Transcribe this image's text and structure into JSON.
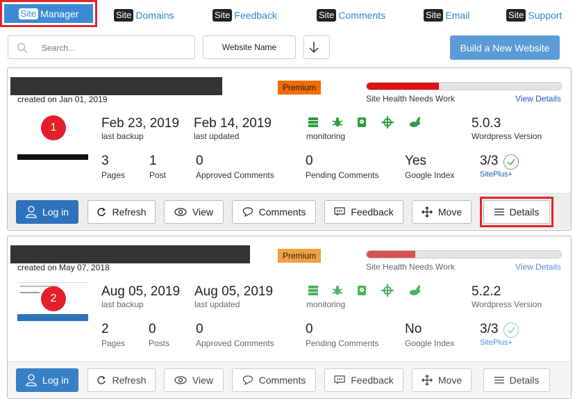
{
  "nav": {
    "site_tag": "Site",
    "items": [
      {
        "label": "Manager"
      },
      {
        "label": "Domains"
      },
      {
        "label": "Feedback"
      },
      {
        "label": "Comments"
      },
      {
        "label": "Email"
      },
      {
        "label": "Support"
      }
    ]
  },
  "toolbar": {
    "search_placeholder": "Search...",
    "sort_label": "Website Name",
    "build_label": "Build a New Website"
  },
  "sites": [
    {
      "badge": "1",
      "created": "created on Jan 01, 2019",
      "plan": "Premium",
      "plan_color": "#ef6c00",
      "health_label": "Site Health Needs Work",
      "health_pct": 0.37,
      "health_color": "#e01010",
      "view_details": "View Details",
      "last_backup": "Feb 23, 2019",
      "last_backup_label": "last backup",
      "last_updated": "Feb 14, 2019",
      "last_updated_label": "last updated",
      "monitoring_label": "monitoring",
      "wp_version": "5.0.3",
      "wp_version_label": "Wordpress Version",
      "pages": "3",
      "pages_label": "Pages",
      "posts": "1",
      "posts_label": "Post",
      "approved": "0",
      "approved_label": "Approved Comments",
      "pending": "0",
      "pending_label": "Pending Comments",
      "google_index": "Yes",
      "google_index_label": "Google Index",
      "siteplus": "3/3",
      "siteplus_label": "SitePlus+"
    },
    {
      "badge": "2",
      "created": "created on May 07, 2018",
      "plan": "Premium",
      "plan_color": "#f0a040",
      "health_label": "Site Health Needs Work",
      "health_pct": 0.25,
      "health_color": "#d9534f",
      "view_details": "View Details",
      "last_backup": "Aug 05, 2019",
      "last_backup_label": "last backup",
      "last_updated": "Aug 05, 2019",
      "last_updated_label": "last updated",
      "monitoring_label": "monitoring",
      "wp_version": "5.2.2",
      "wp_version_label": "Wordpress Version",
      "pages": "2",
      "pages_label": "Pages",
      "posts": "0",
      "posts_label": "Posts",
      "approved": "0",
      "approved_label": "Approved Comments",
      "pending": "0",
      "pending_label": "Pending Comments",
      "google_index": "No",
      "google_index_label": "Google Index",
      "siteplus": "3/3",
      "siteplus_label": "SitePlus+"
    }
  ],
  "actions": {
    "login": "Log in",
    "refresh": "Refresh",
    "view": "View",
    "comments": "Comments",
    "feedback": "Feedback",
    "move": "Move",
    "details": "Details"
  }
}
